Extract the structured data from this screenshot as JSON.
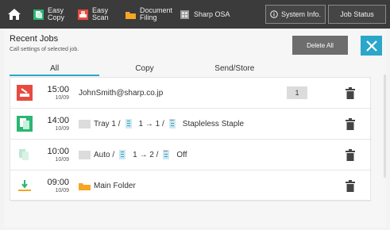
{
  "topbar": {
    "items": [
      {
        "label": "Easy\nCopy",
        "icon": "easy-copy-icon",
        "color": "#2bb673"
      },
      {
        "label": "Easy\nScan",
        "icon": "easy-scan-icon",
        "color": "#e84a3f"
      },
      {
        "label": "Document\nFiling",
        "icon": "document-filing-icon",
        "color": "#f5a623"
      },
      {
        "label": "Sharp OSA",
        "icon": "sharp-osa-icon",
        "color": "#9a9a9a"
      }
    ],
    "system_info": "System Info.",
    "job_status": "Job Status"
  },
  "panel": {
    "title": "Recent Jobs",
    "subtitle": "Call settings of selected job.",
    "delete_all": "Delete All"
  },
  "tabs": [
    {
      "label": "All",
      "active": true
    },
    {
      "label": "Copy",
      "active": false
    },
    {
      "label": "Send/Store",
      "active": false
    }
  ],
  "jobs": [
    {
      "icon": "email-scan-icon",
      "time": "15:00",
      "date": "10/09",
      "text": "JohnSmith@sharp.co.jp",
      "count": "1"
    },
    {
      "icon": "copy-job-icon",
      "time": "14:00",
      "date": "10/09",
      "source": "Tray 1 /",
      "duplex": "1 → 1 /",
      "finish": "Stapleless Staple"
    },
    {
      "icon": "copy-job-icon-faded",
      "time": "10:00",
      "date": "10/09",
      "source": "Auto /",
      "duplex": "1 → 2 /",
      "finish": "Off"
    },
    {
      "icon": "store-job-icon",
      "time": "09:00",
      "date": "10/09",
      "text": "Main Folder"
    }
  ],
  "colors": {
    "accent": "#2aa7c9",
    "topbar": "#3b3b3b"
  }
}
